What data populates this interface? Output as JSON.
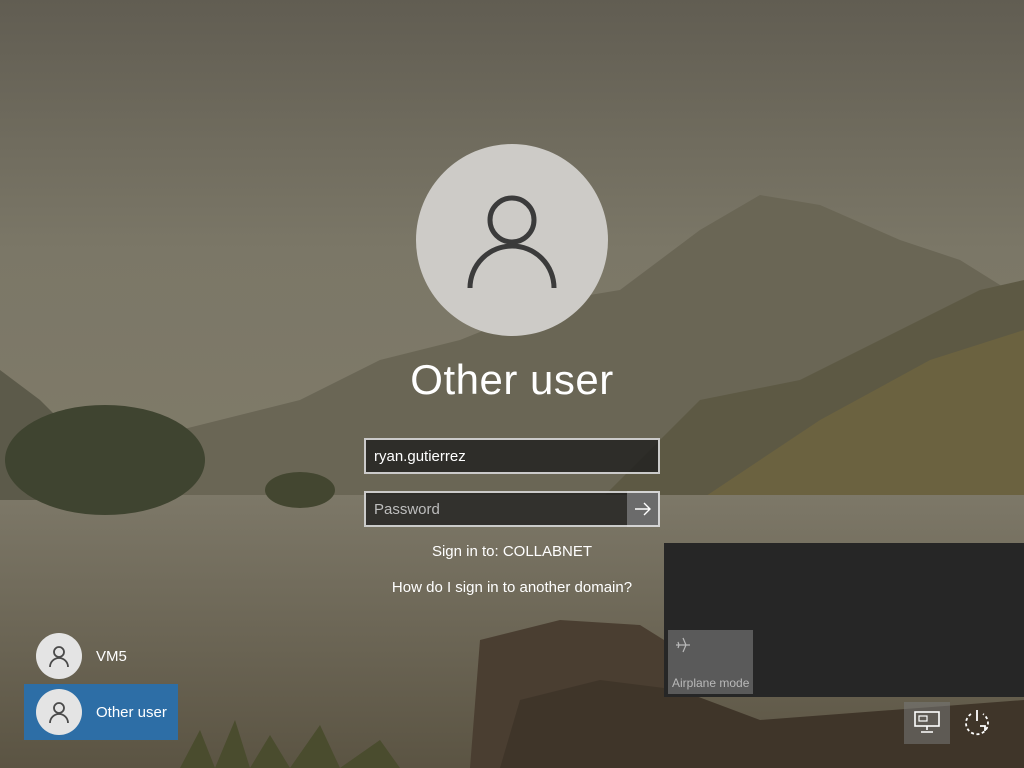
{
  "login": {
    "title": "Other user",
    "username_value": "ryan.gutierrez",
    "password_placeholder": "Password",
    "sign_in_to": "Sign in to: COLLABNET",
    "other_domain_link": "How do I sign in to another domain?"
  },
  "user_list": [
    {
      "name": "VM5",
      "selected": false
    },
    {
      "name": "Other user",
      "selected": true
    }
  ],
  "network_flyout": {
    "airplane_mode_label": "Airplane mode"
  },
  "icons": {
    "avatar": "user-silhouette-icon",
    "submit": "arrow-right-icon",
    "airplane": "airplane-icon",
    "network": "network-icon",
    "power": "power-icon"
  },
  "colors": {
    "selected_user_bg": "#2d6ea6",
    "flyout_bg": "#262626"
  }
}
